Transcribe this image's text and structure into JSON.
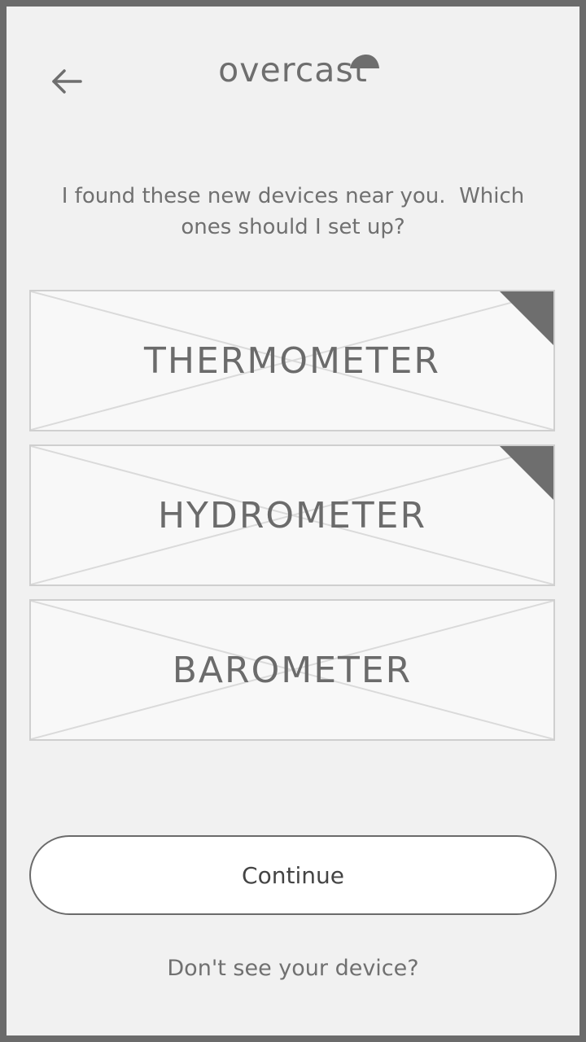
{
  "header": {
    "back_icon": "arrow-left-icon",
    "logo_text": "overcast",
    "logo_icon": "umbrella-icon"
  },
  "prompt": {
    "text": "I found these new devices near you.  Which ones should I set up?"
  },
  "devices": [
    {
      "label": "THERMOMETER",
      "selected": true
    },
    {
      "label": "HYDROMETER",
      "selected": true
    },
    {
      "label": "BAROMETER",
      "selected": false
    }
  ],
  "actions": {
    "continue_label": "Continue",
    "help_link": "Don't see your device?"
  },
  "colors": {
    "frame": "#6b6b6b",
    "background": "#f1f1f1",
    "card_background": "#f8f8f8",
    "card_border": "#cfcfcf",
    "selected_marker": "#6e6e6e",
    "text": "#6e6e6e"
  }
}
